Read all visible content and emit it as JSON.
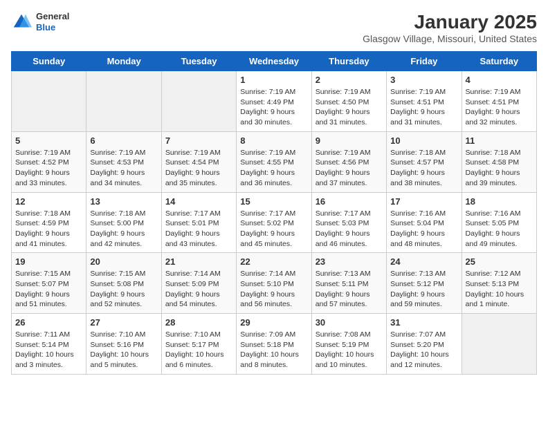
{
  "header": {
    "logo": {
      "general": "General",
      "blue": "Blue"
    },
    "title": "January 2025",
    "subtitle": "Glasgow Village, Missouri, United States"
  },
  "days_of_week": [
    "Sunday",
    "Monday",
    "Tuesday",
    "Wednesday",
    "Thursday",
    "Friday",
    "Saturday"
  ],
  "weeks": [
    [
      {
        "day": "",
        "detail": ""
      },
      {
        "day": "",
        "detail": ""
      },
      {
        "day": "",
        "detail": ""
      },
      {
        "day": "1",
        "detail": "Sunrise: 7:19 AM\nSunset: 4:49 PM\nDaylight: 9 hours\nand 30 minutes."
      },
      {
        "day": "2",
        "detail": "Sunrise: 7:19 AM\nSunset: 4:50 PM\nDaylight: 9 hours\nand 31 minutes."
      },
      {
        "day": "3",
        "detail": "Sunrise: 7:19 AM\nSunset: 4:51 PM\nDaylight: 9 hours\nand 31 minutes."
      },
      {
        "day": "4",
        "detail": "Sunrise: 7:19 AM\nSunset: 4:51 PM\nDaylight: 9 hours\nand 32 minutes."
      }
    ],
    [
      {
        "day": "5",
        "detail": "Sunrise: 7:19 AM\nSunset: 4:52 PM\nDaylight: 9 hours\nand 33 minutes."
      },
      {
        "day": "6",
        "detail": "Sunrise: 7:19 AM\nSunset: 4:53 PM\nDaylight: 9 hours\nand 34 minutes."
      },
      {
        "day": "7",
        "detail": "Sunrise: 7:19 AM\nSunset: 4:54 PM\nDaylight: 9 hours\nand 35 minutes."
      },
      {
        "day": "8",
        "detail": "Sunrise: 7:19 AM\nSunset: 4:55 PM\nDaylight: 9 hours\nand 36 minutes."
      },
      {
        "day": "9",
        "detail": "Sunrise: 7:19 AM\nSunset: 4:56 PM\nDaylight: 9 hours\nand 37 minutes."
      },
      {
        "day": "10",
        "detail": "Sunrise: 7:18 AM\nSunset: 4:57 PM\nDaylight: 9 hours\nand 38 minutes."
      },
      {
        "day": "11",
        "detail": "Sunrise: 7:18 AM\nSunset: 4:58 PM\nDaylight: 9 hours\nand 39 minutes."
      }
    ],
    [
      {
        "day": "12",
        "detail": "Sunrise: 7:18 AM\nSunset: 4:59 PM\nDaylight: 9 hours\nand 41 minutes."
      },
      {
        "day": "13",
        "detail": "Sunrise: 7:18 AM\nSunset: 5:00 PM\nDaylight: 9 hours\nand 42 minutes."
      },
      {
        "day": "14",
        "detail": "Sunrise: 7:17 AM\nSunset: 5:01 PM\nDaylight: 9 hours\nand 43 minutes."
      },
      {
        "day": "15",
        "detail": "Sunrise: 7:17 AM\nSunset: 5:02 PM\nDaylight: 9 hours\nand 45 minutes."
      },
      {
        "day": "16",
        "detail": "Sunrise: 7:17 AM\nSunset: 5:03 PM\nDaylight: 9 hours\nand 46 minutes."
      },
      {
        "day": "17",
        "detail": "Sunrise: 7:16 AM\nSunset: 5:04 PM\nDaylight: 9 hours\nand 48 minutes."
      },
      {
        "day": "18",
        "detail": "Sunrise: 7:16 AM\nSunset: 5:05 PM\nDaylight: 9 hours\nand 49 minutes."
      }
    ],
    [
      {
        "day": "19",
        "detail": "Sunrise: 7:15 AM\nSunset: 5:07 PM\nDaylight: 9 hours\nand 51 minutes."
      },
      {
        "day": "20",
        "detail": "Sunrise: 7:15 AM\nSunset: 5:08 PM\nDaylight: 9 hours\nand 52 minutes."
      },
      {
        "day": "21",
        "detail": "Sunrise: 7:14 AM\nSunset: 5:09 PM\nDaylight: 9 hours\nand 54 minutes."
      },
      {
        "day": "22",
        "detail": "Sunrise: 7:14 AM\nSunset: 5:10 PM\nDaylight: 9 hours\nand 56 minutes."
      },
      {
        "day": "23",
        "detail": "Sunrise: 7:13 AM\nSunset: 5:11 PM\nDaylight: 9 hours\nand 57 minutes."
      },
      {
        "day": "24",
        "detail": "Sunrise: 7:13 AM\nSunset: 5:12 PM\nDaylight: 9 hours\nand 59 minutes."
      },
      {
        "day": "25",
        "detail": "Sunrise: 7:12 AM\nSunset: 5:13 PM\nDaylight: 10 hours\nand 1 minute."
      }
    ],
    [
      {
        "day": "26",
        "detail": "Sunrise: 7:11 AM\nSunset: 5:14 PM\nDaylight: 10 hours\nand 3 minutes."
      },
      {
        "day": "27",
        "detail": "Sunrise: 7:10 AM\nSunset: 5:16 PM\nDaylight: 10 hours\nand 5 minutes."
      },
      {
        "day": "28",
        "detail": "Sunrise: 7:10 AM\nSunset: 5:17 PM\nDaylight: 10 hours\nand 6 minutes."
      },
      {
        "day": "29",
        "detail": "Sunrise: 7:09 AM\nSunset: 5:18 PM\nDaylight: 10 hours\nand 8 minutes."
      },
      {
        "day": "30",
        "detail": "Sunrise: 7:08 AM\nSunset: 5:19 PM\nDaylight: 10 hours\nand 10 minutes."
      },
      {
        "day": "31",
        "detail": "Sunrise: 7:07 AM\nSunset: 5:20 PM\nDaylight: 10 hours\nand 12 minutes."
      },
      {
        "day": "",
        "detail": ""
      }
    ]
  ]
}
